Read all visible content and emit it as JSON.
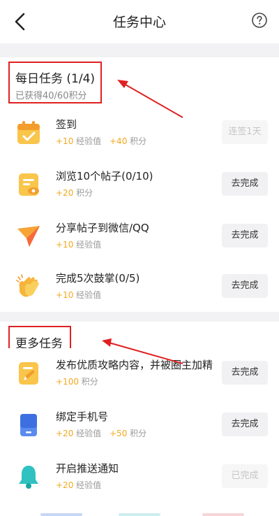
{
  "header": {
    "title": "任务中心",
    "back_icon": "chevron-left-icon",
    "help_icon": "question-circle-icon"
  },
  "daily": {
    "title": "每日任务 (1/4)",
    "subtitle": "已获得40/60积分",
    "tasks": [
      {
        "name": "签到",
        "icon": "calendar-check-icon",
        "rewards": [
          {
            "num": "+10",
            "label": "经验值"
          },
          {
            "num": "+40",
            "label": "积分"
          }
        ],
        "button": "连签1天",
        "button_state": "disabled"
      },
      {
        "name": "浏览10个帖子(0/10)",
        "icon": "document-eye-icon",
        "rewards": [
          {
            "num": "+20",
            "label": "积分"
          }
        ],
        "button": "去完成",
        "button_state": "active"
      },
      {
        "name": "分享帖子到微信/QQ",
        "icon": "share-plane-icon",
        "rewards": [
          {
            "num": "+10",
            "label": "经验值"
          }
        ],
        "button": "去完成",
        "button_state": "active"
      },
      {
        "name": "完成5次鼓掌(0/5)",
        "icon": "clapping-hands-icon",
        "rewards": [
          {
            "num": "+10",
            "label": "经验值"
          }
        ],
        "button": "去完成",
        "button_state": "active"
      }
    ]
  },
  "more": {
    "title": "更多任务",
    "tasks": [
      {
        "name": "发布优质攻略内容，并被圈主加精",
        "icon": "edit-document-icon",
        "rewards": [
          {
            "num": "+100",
            "label": "积分"
          }
        ],
        "button": "去完成",
        "button_state": "active"
      },
      {
        "name": "绑定手机号",
        "icon": "phone-icon",
        "rewards": [
          {
            "num": "+20",
            "label": "经验值"
          },
          {
            "num": "+50",
            "label": "积分"
          }
        ],
        "button": "去完成",
        "button_state": "active"
      },
      {
        "name": "开启推送通知",
        "icon": "bell-icon",
        "rewards": [
          {
            "num": "+20",
            "label": "经验值"
          }
        ],
        "button": "已完成",
        "button_state": "disabled"
      }
    ]
  },
  "colors": {
    "accent_orange": "#f2a81c",
    "annotation_red": "#e02020",
    "button_bg": "#f1f1f3",
    "divider": "#f2f2f4"
  }
}
